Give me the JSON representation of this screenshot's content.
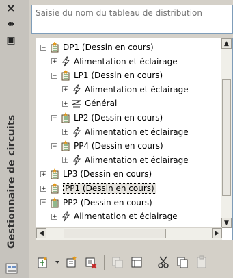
{
  "panel": {
    "title": "Gestionnaire de circuits",
    "close_glyph": "×",
    "pin_glyph": "⇹",
    "properties_glyph": "▣"
  },
  "search": {
    "placeholder": "Saisie du nom du tableau de distribution",
    "value": ""
  },
  "tree": [
    {
      "label": "DP1 (Dessin en cours)",
      "icon": "panel-icon",
      "expander": "−"
    },
    {
      "label": "Alimentation et éclairage",
      "icon": "lightning-icon",
      "expander": "+"
    },
    {
      "label": "LP1 (Dessin en cours)",
      "icon": "panel-icon",
      "expander": "−"
    },
    {
      "label": "Alimentation et éclairage",
      "icon": "lightning-icon",
      "expander": "+"
    },
    {
      "label": "Général",
      "icon": "zigzag-icon",
      "expander": "+"
    },
    {
      "label": "LP2 (Dessin en cours)",
      "icon": "panel-icon",
      "expander": "−"
    },
    {
      "label": "Alimentation et éclairage",
      "icon": "lightning-icon",
      "expander": "+"
    },
    {
      "label": "PP4 (Dessin en cours)",
      "icon": "panel-icon",
      "expander": "−"
    },
    {
      "label": "Alimentation et éclairage",
      "icon": "lightning-icon",
      "expander": "+"
    },
    {
      "label": "LP3 (Dessin en cours)",
      "icon": "panel-icon",
      "expander": "+"
    },
    {
      "label": "PP1 (Dessin en cours)",
      "icon": "panel-icon",
      "expander": "+",
      "selected": true
    },
    {
      "label": "PP2 (Dessin en cours)",
      "icon": "panel-icon",
      "expander": "−"
    },
    {
      "label": "Alimentation et éclairage",
      "icon": "lightning-icon",
      "expander": "+"
    }
  ],
  "colors": {
    "accent_red": "#c62828",
    "icon_green": "#2e7d32",
    "icon_orange": "#e69a1a"
  }
}
